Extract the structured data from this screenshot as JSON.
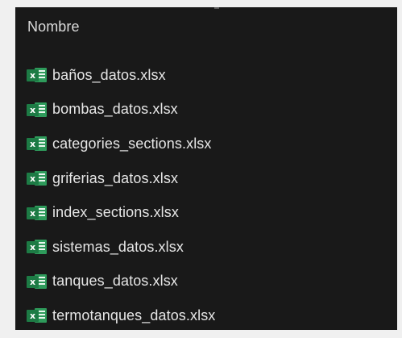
{
  "header": {
    "name_column_label": "Nombre"
  },
  "files": [
    {
      "name": "baños_datos.xlsx",
      "icon": "excel-file-icon",
      "badge": "x"
    },
    {
      "name": "bombas_datos.xlsx",
      "icon": "excel-file-icon",
      "badge": "x"
    },
    {
      "name": "categories_sections.xlsx",
      "icon": "excel-file-icon",
      "badge": "x"
    },
    {
      "name": "griferias_datos.xlsx",
      "icon": "excel-file-icon",
      "badge": "x"
    },
    {
      "name": "index_sections.xlsx",
      "icon": "excel-file-icon",
      "badge": "x"
    },
    {
      "name": "sistemas_datos.xlsx",
      "icon": "excel-file-icon",
      "badge": "x"
    },
    {
      "name": "tanques_datos.xlsx",
      "icon": "excel-file-icon",
      "badge": "x"
    },
    {
      "name": "termotanques_datos.xlsx",
      "icon": "excel-file-icon",
      "badge": "x"
    }
  ],
  "colors": {
    "background": "#191919",
    "text": "#e6e6e6",
    "excel_green": "#1d7b45"
  }
}
